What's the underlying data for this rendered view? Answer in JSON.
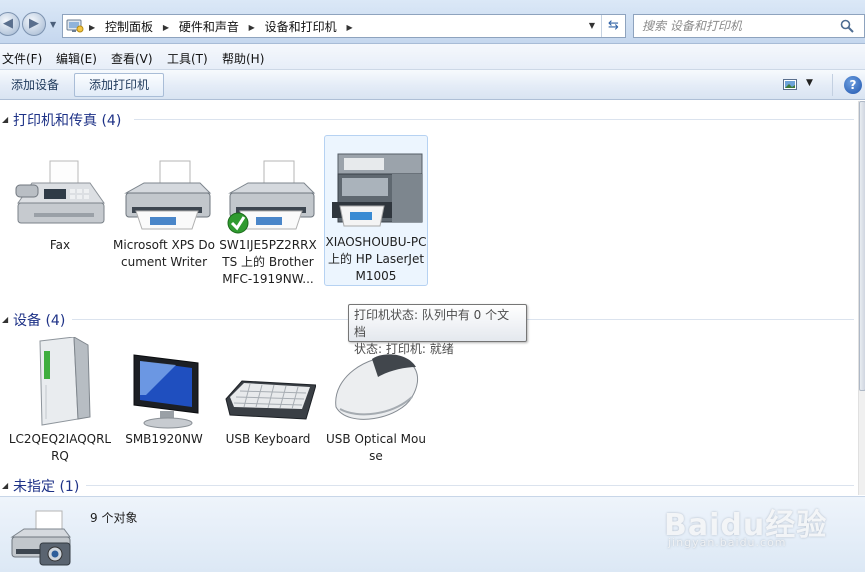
{
  "breadcrumbs": [
    "控制面板",
    "硬件和声音",
    "设备和打印机"
  ],
  "search": {
    "placeholder": "搜索 设备和打印机"
  },
  "menu": [
    "文件(F)",
    "编辑(E)",
    "查看(V)",
    "工具(T)",
    "帮助(H)"
  ],
  "toolbar": {
    "add_device": "添加设备",
    "add_printer": "添加打印机"
  },
  "groups": {
    "printers": {
      "title": "打印机和传真 (4)",
      "items": [
        {
          "label": "Fax",
          "icon": "fax-icon"
        },
        {
          "label": "Microsoft XPS Document Writer",
          "icon": "printer-icon"
        },
        {
          "label": "SW1IJE5PZ2RRXTS 上的 Brother MFC-1919NW...",
          "icon": "default-printer-icon",
          "default": true
        },
        {
          "label": "XIAOSHOUBU-PC 上的 HP LaserJet M1005",
          "icon": "laserjet-printer-icon",
          "selected": true
        }
      ]
    },
    "devices": {
      "title": "设备 (4)",
      "items": [
        {
          "label": "LC2QEQ2IAQQRLRQ",
          "icon": "computer-tower-icon"
        },
        {
          "label": "SMB1920NW",
          "icon": "monitor-icon"
        },
        {
          "label": "USB Keyboard",
          "icon": "keyboard-icon"
        },
        {
          "label": "USB Optical Mouse",
          "icon": "mouse-icon"
        }
      ]
    },
    "unspecified": {
      "title": "未指定 (1)"
    }
  },
  "tooltip": {
    "line1": "打印机状态: 队列中有 0 个文档",
    "line2": "状态: 打印机: 就绪"
  },
  "details": {
    "count": "9 个对象"
  },
  "watermark": {
    "brand": "Baidu经验",
    "url": "jingyan.baidu.com"
  }
}
